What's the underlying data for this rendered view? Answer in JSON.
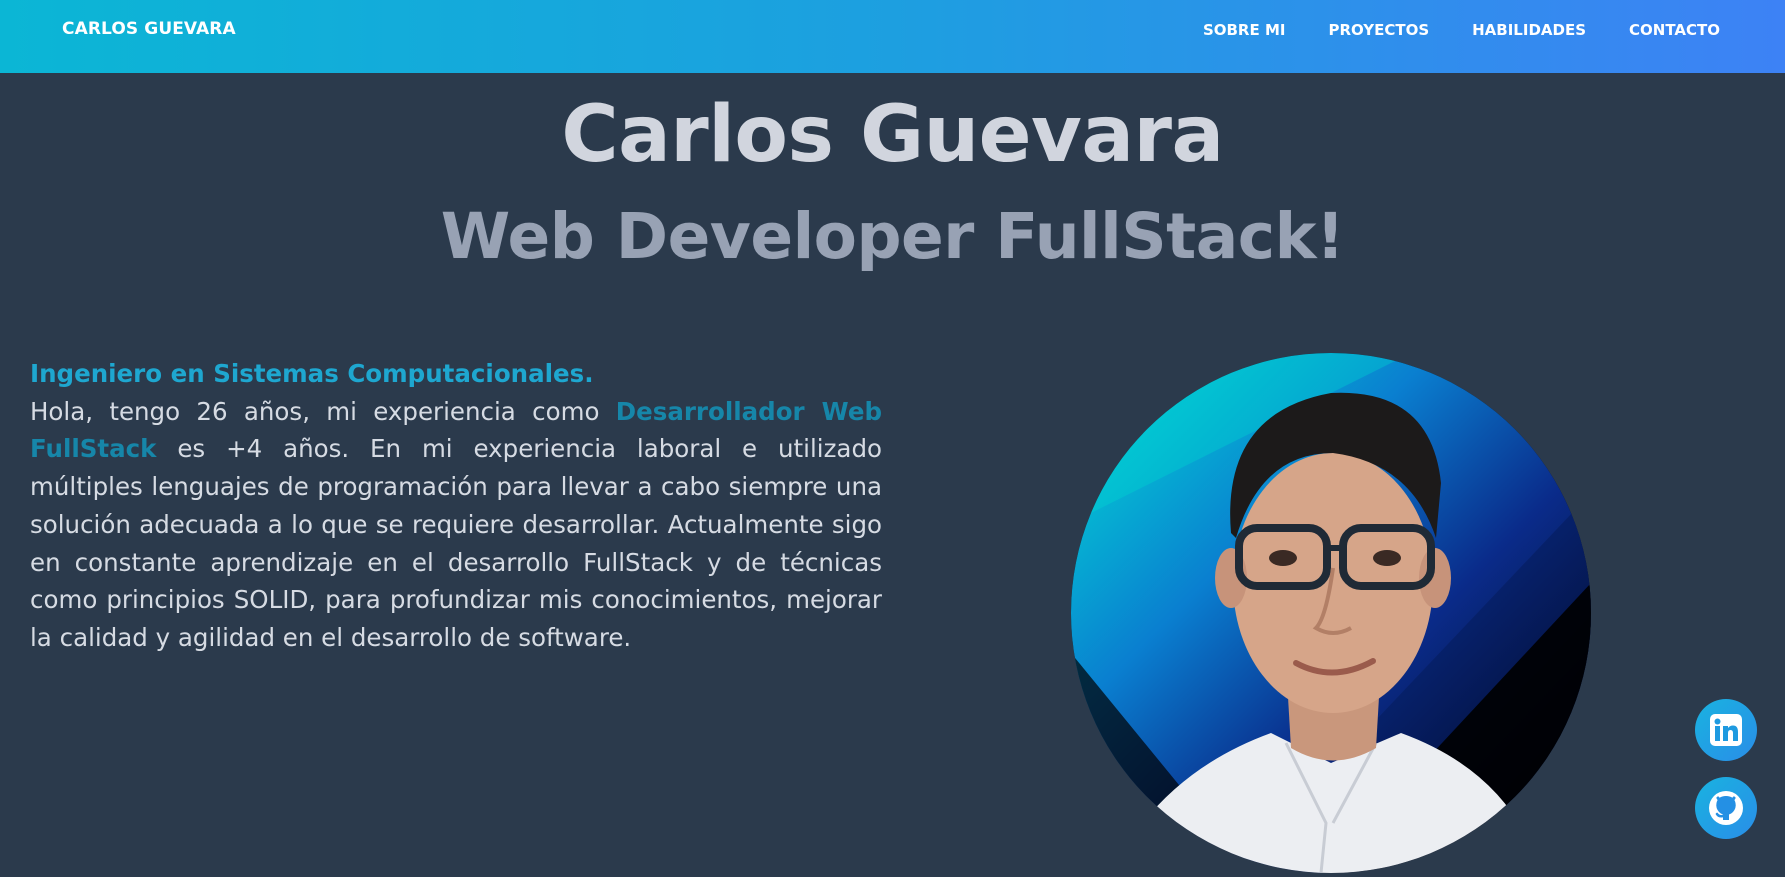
{
  "navbar": {
    "brand": "CARLOS GUEVARA",
    "links": [
      "SOBRE MI",
      "PROYECTOS",
      "HABILIDADES",
      "CONTACTO"
    ]
  },
  "hero": {
    "name": "Carlos Guevara",
    "role": "Web Developer FullStack!"
  },
  "about": {
    "title": "Ingeniero en Sistemas Computacionales.",
    "text_before": "Hola, tengo 26 años, mi experiencia como ",
    "highlight": "Desarrollador Web FullStack",
    "text_after": " es +4 años. En mi experiencia laboral e utilizado múltiples lenguajes de programación para llevar a cabo siempre una solución adecuada a lo que se requiere desarrollar. Actualmente sigo en constante aprendizaje en el desarrollo FullStack y de técnicas como principios SOLID, para profundizar mis conocimientos, mejorar la calidad y agilidad en el desarrollo de software."
  },
  "social": {
    "items": [
      "linkedin-icon",
      "github-icon"
    ]
  },
  "colors": {
    "nav_start": "#0bb6d5",
    "nav_end": "#3d82f5",
    "background": "#2b3a4c",
    "accent": "#1ea7d0"
  }
}
